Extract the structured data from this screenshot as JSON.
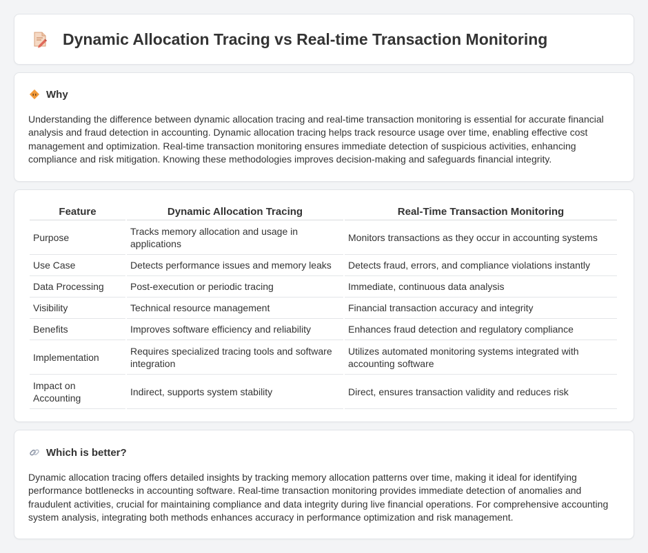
{
  "header": {
    "title": "Dynamic Allocation Tracing vs Real-time Transaction Monitoring",
    "icon": "document-pencil-icon"
  },
  "why": {
    "heading": "Why",
    "icon": "diamond-icon",
    "text": "Understanding the difference between dynamic allocation tracing and real-time transaction monitoring is essential for accurate financial analysis and fraud detection in accounting. Dynamic allocation tracing helps track resource usage over time, enabling effective cost management and optimization. Real-time transaction monitoring ensures immediate detection of suspicious activities, enhancing compliance and risk mitigation. Knowing these methodologies improves decision-making and safeguards financial integrity."
  },
  "table": {
    "headers": [
      "Feature",
      "Dynamic Allocation Tracing",
      "Real-Time Transaction Monitoring"
    ],
    "rows": [
      {
        "feature": "Purpose",
        "dynamic": "Tracks memory allocation and usage in applications",
        "realtime": "Monitors transactions as they occur in accounting systems"
      },
      {
        "feature": "Use Case",
        "dynamic": "Detects performance issues and memory leaks",
        "realtime": "Detects fraud, errors, and compliance violations instantly"
      },
      {
        "feature": "Data Processing",
        "dynamic": "Post-execution or periodic tracing",
        "realtime": "Immediate, continuous data analysis"
      },
      {
        "feature": "Visibility",
        "dynamic": "Technical resource management",
        "realtime": "Financial transaction accuracy and integrity"
      },
      {
        "feature": "Benefits",
        "dynamic": "Improves software efficiency and reliability",
        "realtime": "Enhances fraud detection and regulatory compliance"
      },
      {
        "feature": "Implementation",
        "dynamic": "Requires specialized tracing tools and software integration",
        "realtime": "Utilizes automated monitoring systems integrated with accounting software"
      },
      {
        "feature": "Impact on Accounting",
        "dynamic": "Indirect, supports system stability",
        "realtime": "Direct, ensures transaction validity and reduces risk"
      }
    ]
  },
  "better": {
    "heading": "Which is better?",
    "icon": "link-icon",
    "text": "Dynamic allocation tracing offers detailed insights by tracking memory allocation patterns over time, making it ideal for identifying performance bottlenecks in accounting software. Real-time transaction monitoring provides immediate detection of anomalies and fraudulent activities, crucial for maintaining compliance and data integrity during live financial operations. For comprehensive accounting system analysis, integrating both methods enhances accuracy in performance optimization and risk management."
  },
  "colors": {
    "background": "#f3f4f6",
    "card": "#ffffff",
    "text": "#333333",
    "accent_orange": "#f29a3a",
    "accent_pink": "#e06a8a"
  }
}
